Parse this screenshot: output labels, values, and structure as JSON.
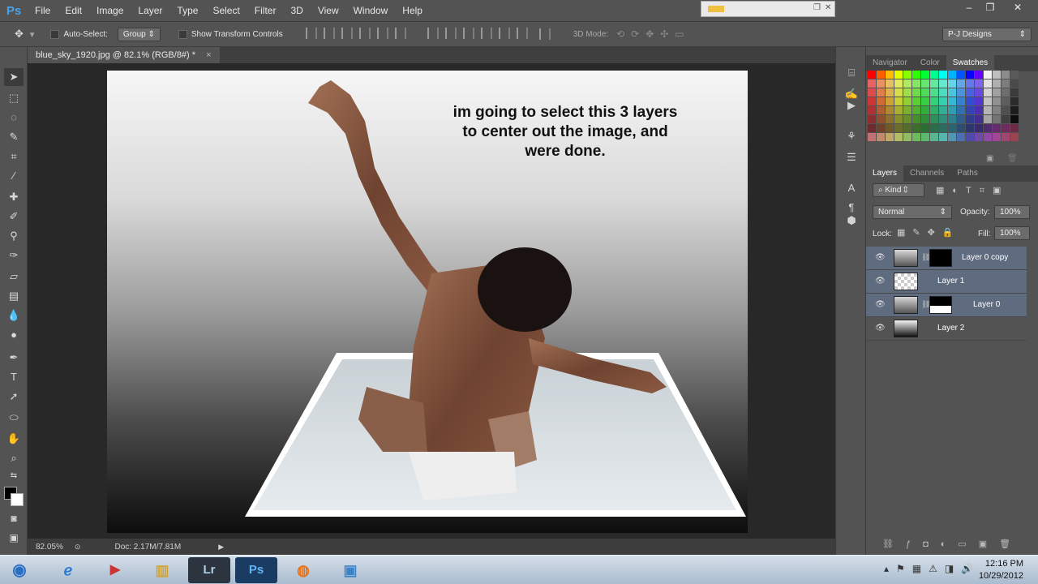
{
  "app": {
    "logo": "Ps",
    "menu": [
      "File",
      "Edit",
      "Image",
      "Layer",
      "Type",
      "Select",
      "Filter",
      "3D",
      "View",
      "Window",
      "Help"
    ],
    "window_controls": [
      "–",
      "❐",
      "✕"
    ]
  },
  "options_bar": {
    "auto_select_label": "Auto-Select:",
    "auto_select_mode": "Group",
    "show_transform_label": "Show Transform Controls",
    "mode_3d_label": "3D Mode:",
    "workspace": "P-J Designs"
  },
  "document": {
    "tab_title": "blue_sky_1920.jpg @ 82.1% (RGB/8#) *",
    "close_glyph": "×",
    "caption_lines": [
      "im going to select this 3 layers",
      "to center out the image, and",
      "were done."
    ]
  },
  "status_bar": {
    "zoom": "82.05%",
    "doc_info": "Doc: 2.17M/7.81M"
  },
  "panels": {
    "top_tabs": [
      "Navigator",
      "Color",
      "Swatches"
    ],
    "top_active": "Swatches",
    "layers_tabs": [
      "Layers",
      "Channels",
      "Paths"
    ],
    "layers_active": "Layers",
    "kind_filter": "Kind",
    "blend_mode": "Normal",
    "opacity_label": "Opacity:",
    "opacity_value": "100%",
    "lock_label": "Lock:",
    "fill_label": "Fill:",
    "fill_value": "100%",
    "layers": [
      {
        "name": "Layer 0 copy",
        "selected": true
      },
      {
        "name": "Layer 1",
        "selected": true
      },
      {
        "name": "Layer 0",
        "selected": true
      },
      {
        "name": "Layer 2",
        "selected": false
      }
    ]
  },
  "taskbar": {
    "time": "12:16 PM",
    "date": "10/29/2012",
    "apps": [
      "Start",
      "Internet Explorer",
      "Media Player",
      "Explorer",
      "Lightroom",
      "Photoshop",
      "Firefox",
      "Image Viewer"
    ],
    "lightroom_label": "Lr",
    "photoshop_label": "Ps"
  },
  "colors": {
    "panel_bg": "#535353",
    "selection": "#5f6c80",
    "ps_blue": "#4aa3e8"
  }
}
